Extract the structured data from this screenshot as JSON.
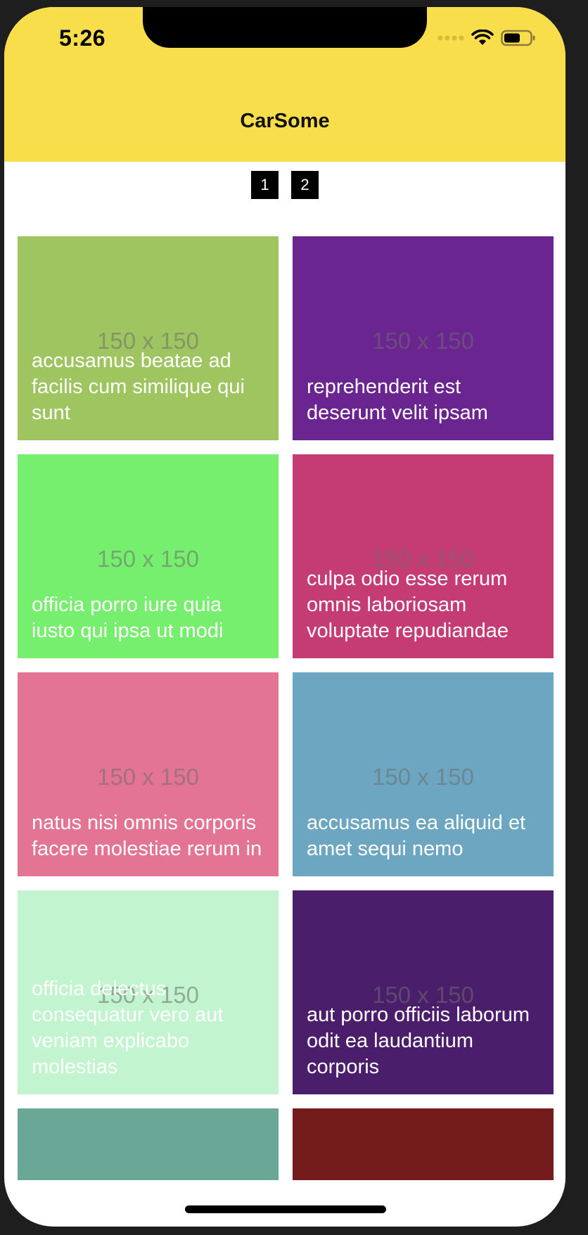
{
  "status_bar": {
    "time": "5:26"
  },
  "header": {
    "title": "CarSome",
    "background": "#f9de4b"
  },
  "pager": {
    "pages": [
      "1",
      "2"
    ]
  },
  "placeholder_text": "150 x 150",
  "cards": [
    {
      "caption": "accusamus beatae ad facilis cum similique qui sunt",
      "color": "#9fc560"
    },
    {
      "caption": "reprehenderit est deserunt velit ipsam",
      "color": "#6b2590"
    },
    {
      "caption": "officia porro iure quia iusto qui ipsa ut modi",
      "color": "#77ef6e"
    },
    {
      "caption": "culpa odio esse rerum omnis laboriosam voluptate repudiandae",
      "color": "#c43c73"
    },
    {
      "caption": "natus nisi omnis corporis facere molestiae rerum in",
      "color": "#e47494"
    },
    {
      "caption": "accusamus ea aliquid et amet sequi nemo",
      "color": "#6ca6c0"
    },
    {
      "caption": "officia delectus consequatur vero aut veniam explicabo molestias",
      "color": "#c1f4cf"
    },
    {
      "caption": "aut porro officiis laborum odit ea laudantium corporis",
      "color": "#4b1e6b"
    },
    {
      "caption": "",
      "color": "#6aa797"
    },
    {
      "caption": "",
      "color": "#741c1c"
    }
  ]
}
